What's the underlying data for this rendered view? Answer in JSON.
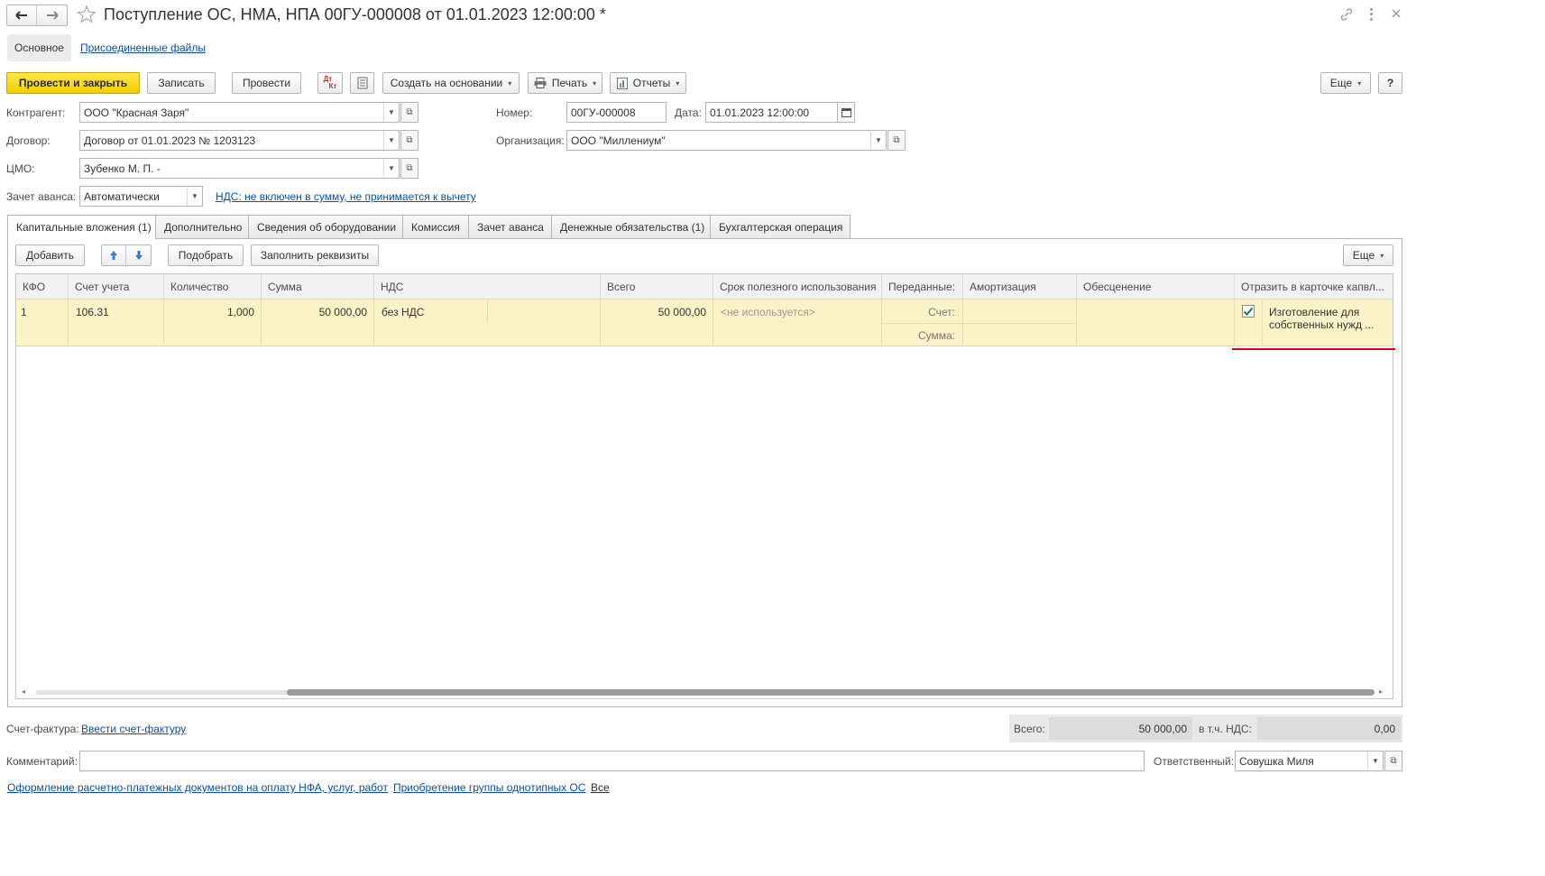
{
  "window": {
    "title": "Поступление ОС, НМА, НПА 00ГУ-000008 от 01.01.2023 12:00:00 *",
    "nav_back_icon": "arrow-left-icon",
    "nav_forward_icon": "arrow-right-icon",
    "star_icon": "star-icon",
    "link_icon": "link-icon",
    "menu_icon": "more-vertical-icon",
    "close_icon": "close-icon"
  },
  "top_tabs": {
    "main": "Основное",
    "attached": "Присоединенные файлы"
  },
  "toolbar": {
    "post_close": "Провести и закрыть",
    "save": "Записать",
    "post": "Провести",
    "dt_kt_icon": "Дт Кт",
    "create_based": "Создать на основании",
    "print": "Печать",
    "reports": "Отчеты",
    "more": "Еще",
    "help": "?"
  },
  "form": {
    "counterparty_label": "Контрагент:",
    "counterparty_value": "ООО \"Красная Заря\"",
    "contract_label": "Договор:",
    "contract_value": "Договор от 01.01.2023 № 1203123",
    "mol_label": "ЦМО:",
    "mol_value": "Зубенко М. П. -",
    "advance_label": "Зачет аванса:",
    "advance_value": "Автоматически",
    "vat_link": "НДС: не включен в сумму, не принимается к вычету",
    "number_label": "Номер:",
    "number_value": "00ГУ-000008",
    "date_label": "Дата:",
    "date_value": "01.01.2023 12:00:00",
    "org_label": "Организация:",
    "org_value": "ООО \"Миллениум\""
  },
  "tabs": [
    "Капитальные вложения (1)",
    "Дополнительно",
    "Сведения об оборудовании",
    "Комиссия",
    "Зачет аванса",
    "Денежные обязательства (1)",
    "Бухгалтерская операция"
  ],
  "table_toolbar": {
    "add": "Добавить",
    "pick": "Подобрать",
    "fill": "Заполнить реквизиты",
    "more": "Еще"
  },
  "table": {
    "headers": [
      "КФО",
      "Счет учета",
      "Количество",
      "Сумма",
      "НДС",
      "Всего",
      "Срок полезного использования",
      "Переданные:",
      "Амортизация",
      "Обесценение",
      "Отразить в карточке капвл..."
    ],
    "row": {
      "kfo": "1",
      "account": "106.31",
      "qty": "1,000",
      "sum": "50 000,00",
      "vat": "без НДС",
      "total": "50 000,00",
      "useful_life": "<не используется>",
      "transferred_account": "Счет:",
      "transferred_sum": "Сумма:",
      "checked": true,
      "reflect_text_1": "Изготовление для",
      "reflect_text_2": "собственных нужд ..."
    }
  },
  "footer": {
    "invoice_label": "Счет-фактура:",
    "invoice_link": "Ввести счет-фактуру",
    "total_label": "Всего:",
    "total_value": "50 000,00",
    "vat_label": "в т.ч. НДС:",
    "vat_value": "0,00",
    "comment_label": "Комментарий:",
    "comment_value": "",
    "responsible_label": "Ответственный:",
    "responsible_value": "Совушка Миля",
    "link1": "Оформление расчетно-платежных документов на оплату НФА, услуг, работ",
    "link2": "Приобретение группы однотипных ОС",
    "link3": "Все"
  },
  "colors": {
    "accent_yellow": "#f5d400",
    "row_highlight": "#fbf3c7",
    "link_blue": "#0a4fb4",
    "red_underline": "#e0001b"
  }
}
